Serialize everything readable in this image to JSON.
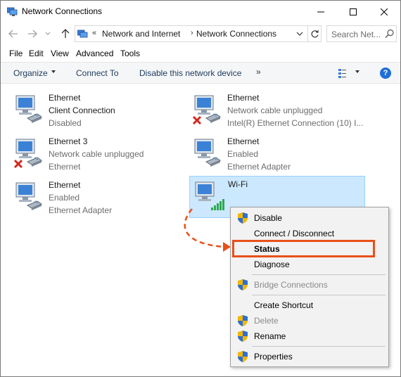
{
  "window": {
    "title": "Network Connections"
  },
  "address": {
    "chevron": "«",
    "crumbs": [
      "Network and Internet",
      "Network Connections"
    ],
    "separator": "›",
    "search_placeholder": "Search Net..."
  },
  "menu": [
    "File",
    "Edit",
    "View",
    "Advanced",
    "Tools"
  ],
  "commands": {
    "organize": "Organize",
    "connect_to": "Connect To",
    "disable_device": "Disable this network device",
    "more": "»",
    "help": "?"
  },
  "adapters": [
    {
      "name": "Ethernet",
      "status": "Client Connection",
      "device": "Disabled",
      "state": "disabled"
    },
    {
      "name": "Ethernet",
      "status": "Network cable unplugged",
      "device": "Intel(R) Ethernet Connection (10) I...",
      "state": "unplugged"
    },
    {
      "name": "Ethernet 3",
      "status": "Network cable unplugged",
      "device": "Ethernet",
      "state": "unplugged"
    },
    {
      "name": "Ethernet",
      "status": "Enabled",
      "device": "Ethernet Adapter",
      "state": "enabled"
    },
    {
      "name": "Ethernet",
      "status": "Enabled",
      "device": "Ethernet Adapter",
      "state": "enabled"
    },
    {
      "name": "Wi-Fi",
      "status": "",
      "device": "",
      "state": "wifi",
      "selected": true
    }
  ],
  "context_menu": {
    "items": [
      {
        "label": "Disable",
        "shield": true,
        "disabled": false
      },
      {
        "label": "Connect / Disconnect",
        "shield": false,
        "disabled": false
      },
      {
        "label": "Status",
        "shield": false,
        "disabled": false,
        "bold": true
      },
      {
        "label": "Diagnose",
        "shield": false,
        "disabled": false
      },
      {
        "label": "Bridge Connections",
        "shield": true,
        "disabled": true
      },
      {
        "label": "Create Shortcut",
        "shield": false,
        "disabled": false
      },
      {
        "label": "Delete",
        "shield": true,
        "disabled": true
      },
      {
        "label": "Rename",
        "shield": true,
        "disabled": false
      },
      {
        "label": "Properties",
        "shield": true,
        "disabled": false
      }
    ]
  },
  "colors": {
    "accent": "#1e6fd6",
    "highlight": "#e8501a",
    "selection": "#cce8ff"
  }
}
